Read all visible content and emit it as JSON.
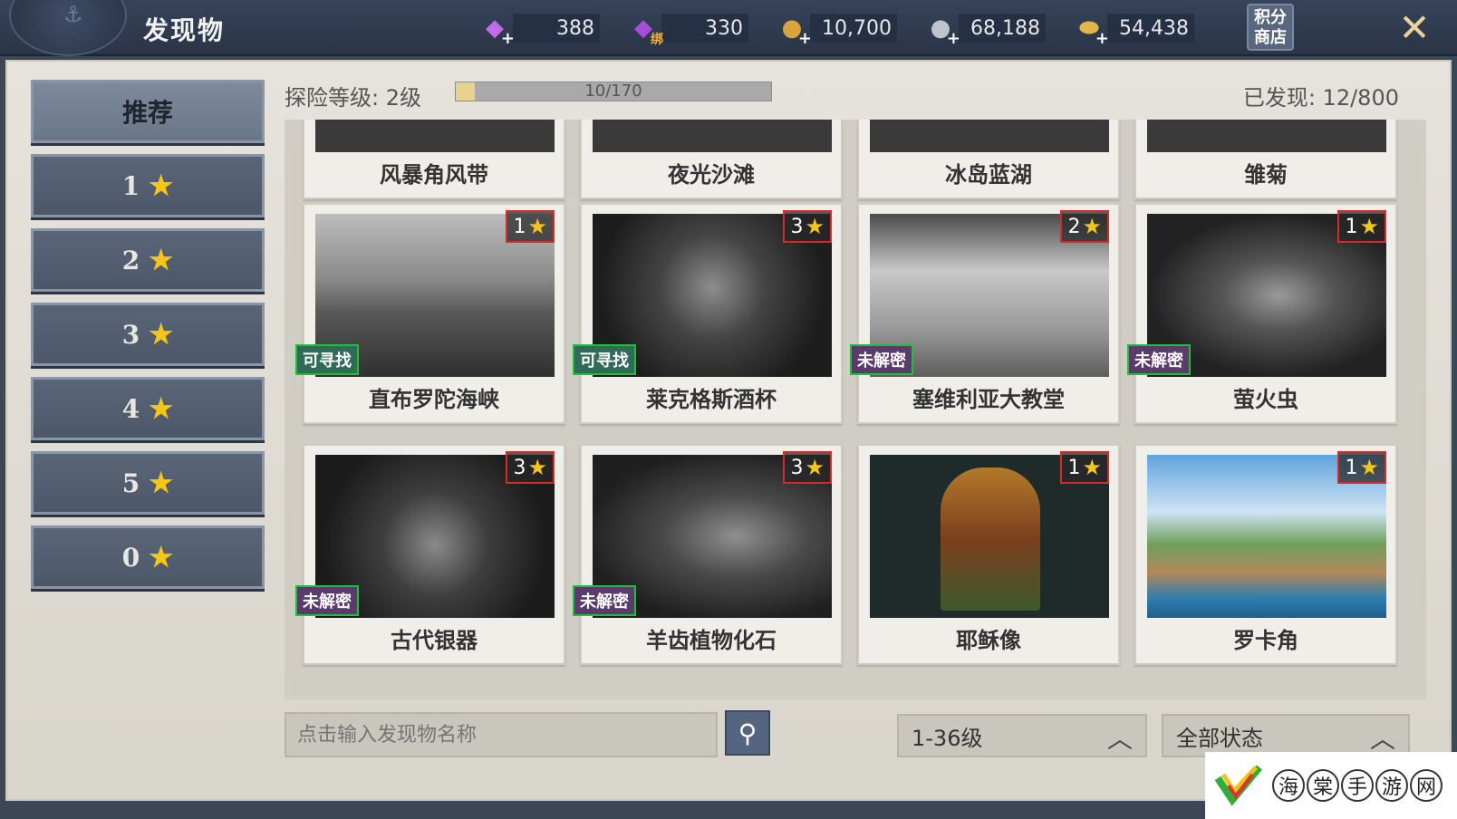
{
  "header": {
    "title": "发现物",
    "currencies": [
      {
        "icon": "purple-diamond-icon",
        "value": "388"
      },
      {
        "icon": "bound-diamond-icon",
        "value": "330",
        "tag": "绑"
      },
      {
        "icon": "gold-coin-icon",
        "value": "10,700"
      },
      {
        "icon": "silver-coin-icon",
        "value": "68,188"
      },
      {
        "icon": "gold-ingot-icon",
        "value": "54,438"
      }
    ],
    "shop_label": "积分商店",
    "close_icon": "close-icon"
  },
  "sidebar": {
    "items": [
      {
        "label": "推荐",
        "active": true
      },
      {
        "label": "1",
        "star": true
      },
      {
        "label": "2",
        "star": true
      },
      {
        "label": "3",
        "star": true
      },
      {
        "label": "4",
        "star": true
      },
      {
        "label": "5",
        "star": true
      },
      {
        "label": "0",
        "star": true
      }
    ]
  },
  "status": {
    "level_label": "探险等级: 2级",
    "progress_text": "10/170",
    "progress_fraction": 0.059,
    "found_label": "已发现: 12/800"
  },
  "cards_top": [
    {
      "name": "风暴角风带"
    },
    {
      "name": "夜光沙滩"
    },
    {
      "name": "冰岛蓝湖"
    },
    {
      "name": "雏菊"
    }
  ],
  "cards": [
    {
      "name": "直布罗陀海峡",
      "stars": "1",
      "status": "可寻找",
      "status_type": "find"
    },
    {
      "name": "莱克格斯酒杯",
      "stars": "3",
      "status": "可寻找",
      "status_type": "find"
    },
    {
      "name": "塞维利亚大教堂",
      "stars": "2",
      "status": "未解密",
      "status_type": "locked"
    },
    {
      "name": "萤火虫",
      "stars": "1",
      "status": "未解密",
      "status_type": "locked"
    },
    {
      "name": "古代银器",
      "stars": "3",
      "status": "未解密",
      "status_type": "locked"
    },
    {
      "name": "羊齿植物化石",
      "stars": "3",
      "status": "未解密",
      "status_type": "locked"
    },
    {
      "name": "耶稣像",
      "stars": "1",
      "status": ""
    },
    {
      "name": "罗卡角",
      "stars": "1",
      "status": ""
    }
  ],
  "search": {
    "placeholder": "点击输入发现物名称"
  },
  "filters": {
    "level_range": "1-36级",
    "state": "全部状态"
  },
  "watermark": {
    "chars": [
      "海",
      "棠",
      "手",
      "游",
      "网"
    ]
  },
  "colors": {
    "star": "#f5c518",
    "badge_border_red": "#d42a2a",
    "badge_border_green": "#1fbf3a"
  }
}
